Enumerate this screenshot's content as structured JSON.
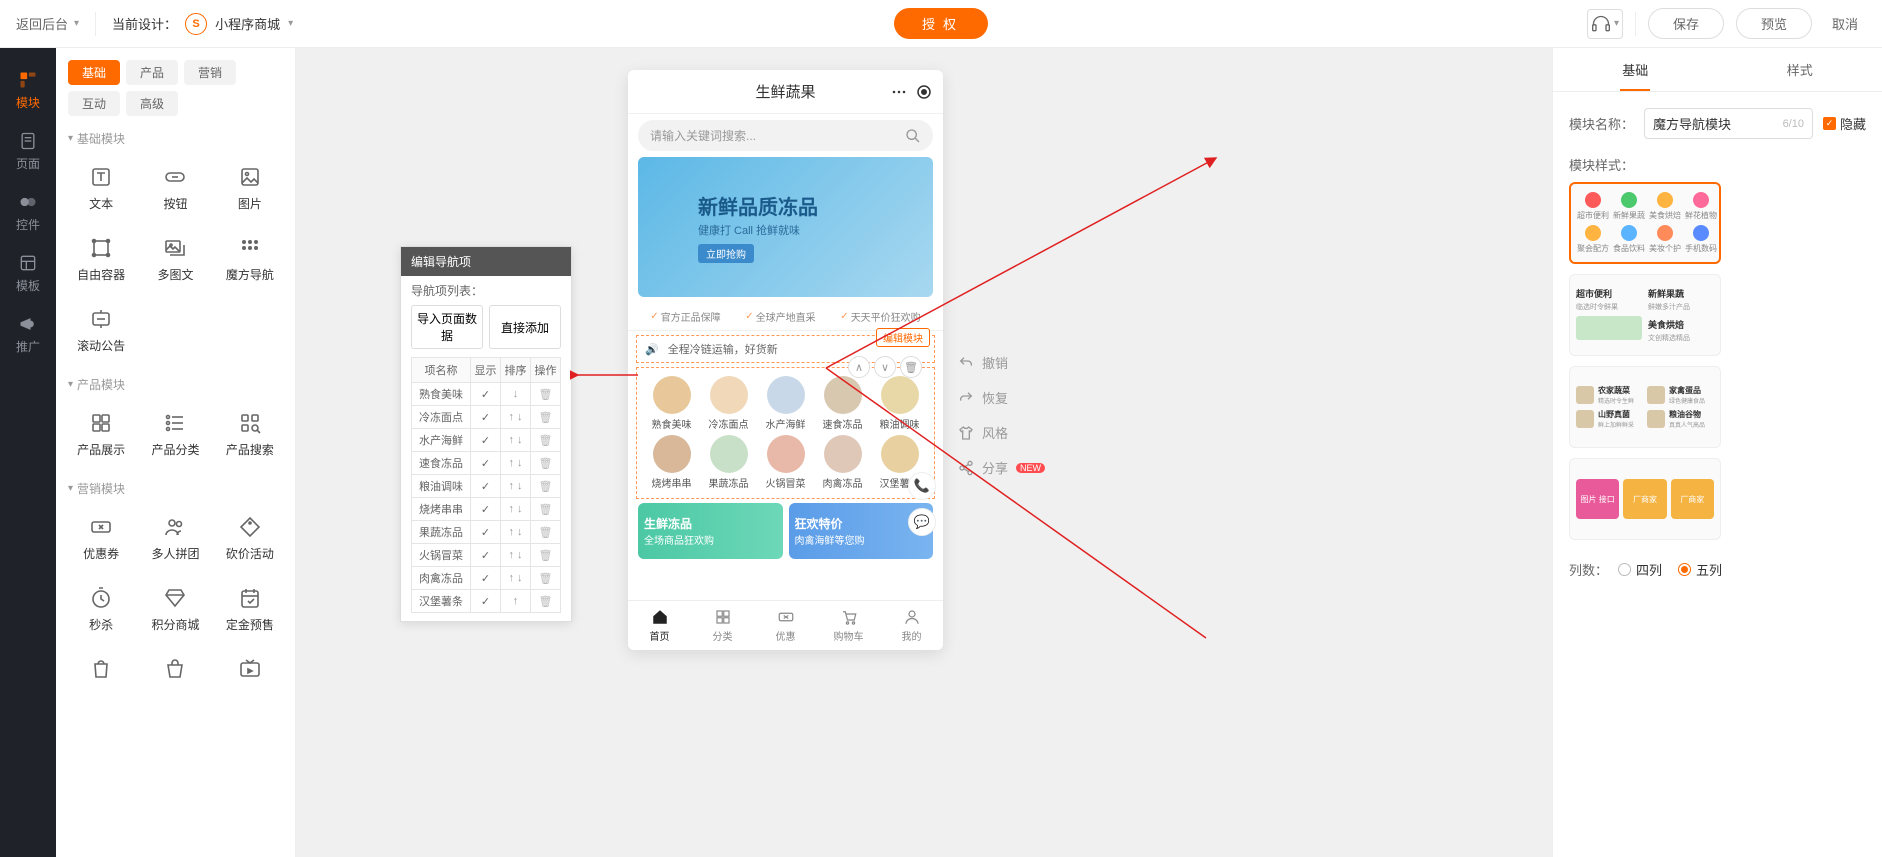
{
  "topbar": {
    "back_label": "返回后台",
    "current_design_label": "当前设计：",
    "design_name": "小程序商城",
    "auth_button": "授权",
    "save": "保存",
    "preview": "预览",
    "cancel": "取消"
  },
  "leftrail": [
    {
      "label": "模块",
      "active": true
    },
    {
      "label": "页面"
    },
    {
      "label": "控件"
    },
    {
      "label": "模板"
    },
    {
      "label": "推广"
    }
  ],
  "comp_tabs": [
    {
      "label": "基础",
      "active": true
    },
    {
      "label": "产品"
    },
    {
      "label": "营销"
    },
    {
      "label": "互动"
    },
    {
      "label": "高级"
    }
  ],
  "sections": [
    {
      "title": "基础模块",
      "items": [
        "文本",
        "按钮",
        "图片",
        "自由容器",
        "多图文",
        "魔方导航",
        "滚动公告"
      ]
    },
    {
      "title": "产品模块",
      "items": [
        "产品展示",
        "产品分类",
        "产品搜索"
      ]
    },
    {
      "title": "营销模块",
      "items": [
        "优惠券",
        "多人拼团",
        "砍价活动",
        "秒杀",
        "积分商城",
        "定金预售",
        "",
        "",
        ""
      ]
    }
  ],
  "popup": {
    "title": "编辑导航项",
    "subtitle": "导航项列表：",
    "btn_import": "导入页面数据",
    "btn_add": "直接添加",
    "cols": {
      "name": "项名称",
      "show": "显示",
      "sort": "排序",
      "op": "操作"
    },
    "rows": [
      "熟食美味",
      "冷冻面点",
      "水产海鲜",
      "速食冻品",
      "粮油调味",
      "烧烤串串",
      "果蔬冻品",
      "火锅冒菜",
      "肉禽冻品",
      "汉堡薯条"
    ]
  },
  "phone": {
    "title": "生鲜蔬果",
    "search_placeholder": "请输入关键词搜索...",
    "banner_big": "新鲜品质冻品",
    "banner_small": "健康打 Call 抢鲜就味",
    "banner_btn": "立即抢购",
    "trust": [
      "官方正品保障",
      "全球产地直采",
      "天天平价狂欢购"
    ],
    "notice": "全程冷链运输，好货新",
    "edit_badge": "编辑模块",
    "nav": [
      "熟食美味",
      "冷冻面点",
      "水产海鲜",
      "速食冻品",
      "粮油调味",
      "烧烤串串",
      "果蔬冻品",
      "火锅冒菜",
      "肉禽冻品",
      "汉堡薯条"
    ],
    "promo1_title": "生鲜冻品",
    "promo1_sub": "全场商品狂欢购",
    "promo2_title": "狂欢特价",
    "promo2_sub": "肉禽海鲜等您购",
    "tabbar": [
      "首页",
      "分类",
      "优惠",
      "购物车",
      "我的"
    ]
  },
  "canvas_ops": {
    "undo": "撤销",
    "redo": "恢复",
    "style": "风格",
    "share": "分享",
    "new_badge": "NEW"
  },
  "right": {
    "tab_basic": "基础",
    "tab_style": "样式",
    "module_name_label": "模块名称：",
    "module_name_value": "魔方导航模块",
    "module_name_counter": "6/10",
    "hide_label": "隐藏",
    "style_label": "模块样式：",
    "cols_label": "列数：",
    "radio_4": "四列",
    "radio_5": "五列",
    "style_card_1_items": [
      "超市便利",
      "新鲜果蔬",
      "美食烘焙",
      "鲜花植物",
      "聚会配方",
      "食品饮料",
      "美妆个护",
      "手机数码"
    ],
    "style_card_2_text1": "超市便利",
    "style_card_2_text1b": "临选时令鲜果",
    "style_card_2_text2": "新鲜果蔬",
    "style_card_2_text2b": "鲜嫩多汁产品",
    "style_card_2_text3": "美食烘焙",
    "style_card_2_text3b": "文创精选精品",
    "style_card_3_items": [
      "农家蔬菜",
      "家禽蛋品",
      "山野真菌",
      "粮油谷物"
    ],
    "style_card_3_subs": [
      "精选时令生鲜",
      "绿色健康食品",
      "鲜上加鲜鲜采",
      "真真人气高品"
    ],
    "style_card_4_items": [
      "图片 接口",
      "厂商家",
      "厂商家"
    ]
  }
}
